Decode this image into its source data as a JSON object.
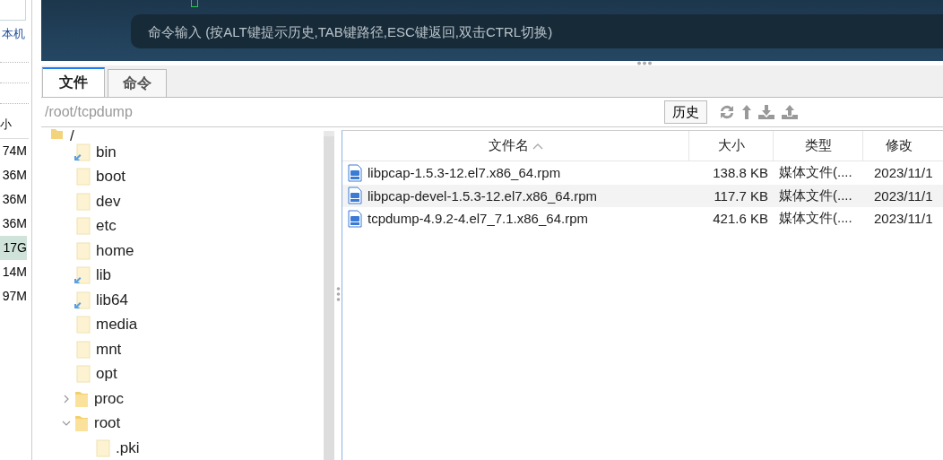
{
  "side_panel": {
    "label": "本机",
    "column_header": "小",
    "sizes": [
      {
        "text": "74M",
        "selected": false
      },
      {
        "text": "36M",
        "selected": false
      },
      {
        "text": "36M",
        "selected": false
      },
      {
        "text": "36M",
        "selected": false
      },
      {
        "text": "17G",
        "selected": true
      },
      {
        "text": "14M",
        "selected": false
      },
      {
        "text": "97M",
        "selected": false
      }
    ]
  },
  "terminal": {
    "command_placeholder": "命令输入 (按ALT键提示历史,TAB键路径,ESC键返回,双击CTRL切换)"
  },
  "tabs": [
    {
      "label": "文件",
      "selected": true
    },
    {
      "label": "命令",
      "selected": false
    }
  ],
  "path_bar": {
    "path": "/root/tcpdump",
    "history_button": "历史"
  },
  "tree": [
    {
      "label": "/",
      "kind": "open",
      "children": [
        {
          "label": "bin",
          "kind": "link"
        },
        {
          "label": "boot",
          "kind": "plain"
        },
        {
          "label": "dev",
          "kind": "plain"
        },
        {
          "label": "etc",
          "kind": "plain"
        },
        {
          "label": "home",
          "kind": "plain"
        },
        {
          "label": "lib",
          "kind": "link"
        },
        {
          "label": "lib64",
          "kind": "link"
        },
        {
          "label": "media",
          "kind": "plain"
        },
        {
          "label": "mnt",
          "kind": "plain"
        },
        {
          "label": "opt",
          "kind": "plain"
        },
        {
          "label": "proc",
          "kind": "folder",
          "expanded": false
        },
        {
          "label": "root",
          "kind": "folder",
          "expanded": true,
          "children": [
            {
              "label": ".pki",
              "kind": "plain"
            }
          ]
        }
      ]
    }
  ],
  "file_table": {
    "columns": [
      {
        "label": "文件名",
        "sorted": true
      },
      {
        "label": "大小",
        "sorted": false
      },
      {
        "label": "类型",
        "sorted": false
      },
      {
        "label": "修改",
        "sorted": false
      }
    ],
    "rows": [
      {
        "name": "libpcap-1.5.3-12.el7.x86_64.rpm",
        "size": "138.8 KB",
        "type": "媒体文件(....",
        "modified": "2023/11/1",
        "hover": false
      },
      {
        "name": "libpcap-devel-1.5.3-12.el7.x86_64.rpm",
        "size": "117.7 KB",
        "type": "媒体文件(....",
        "modified": "2023/11/1",
        "hover": true
      },
      {
        "name": "tcpdump-4.9.2-4.el7_7.1.x86_64.rpm",
        "size": "421.6 KB",
        "type": "媒体文件(....",
        "modified": "2023/11/1",
        "hover": false
      }
    ]
  }
}
